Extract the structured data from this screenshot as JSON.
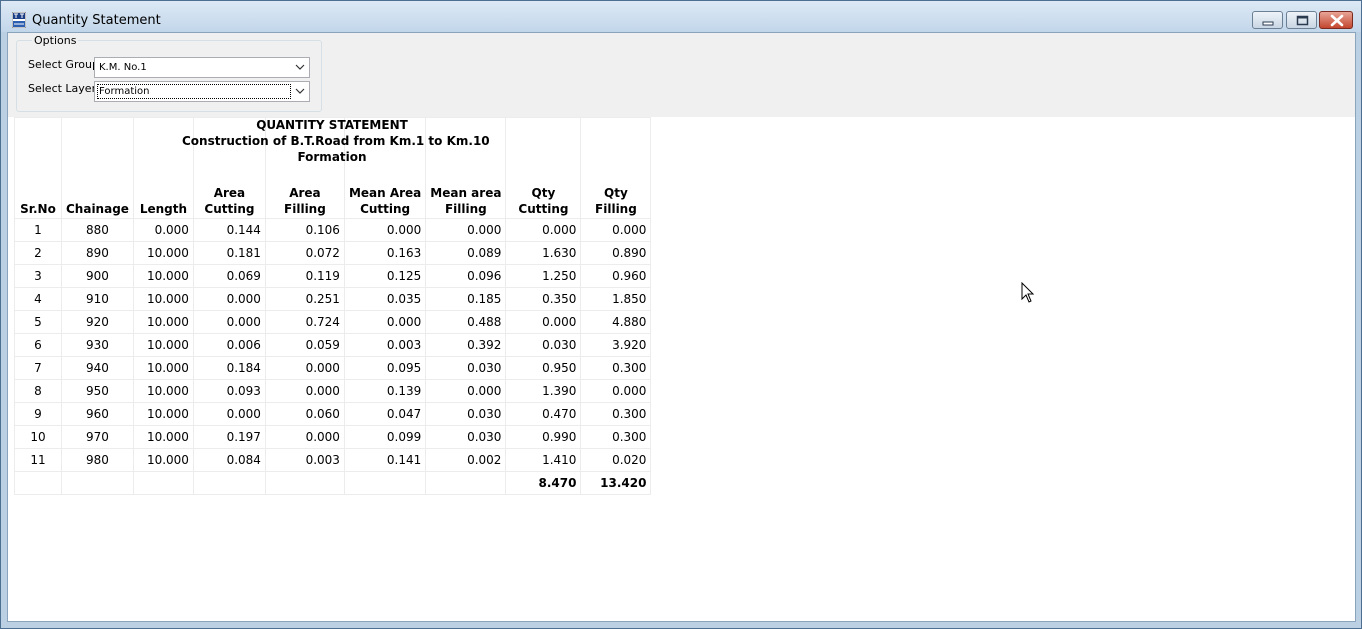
{
  "window": {
    "title": "Quantity Statement"
  },
  "options": {
    "legend": "Options",
    "group_label": "Select Group",
    "group_value": "K.M. No.1",
    "layer_label": "Select Layer",
    "layer_value": "Formation"
  },
  "report": {
    "title": "QUANTITY STATEMENT",
    "subtitle": "Construction of B.T.Road from Km.1 to Km.10",
    "layer": "Formation",
    "columns": [
      [
        "Sr.No"
      ],
      [
        "Chainage"
      ],
      [
        "Length"
      ],
      [
        "Area",
        "Cutting"
      ],
      [
        "Area",
        "Filling"
      ],
      [
        "Mean Area",
        "Cutting"
      ],
      [
        "Mean area",
        "Filling"
      ],
      [
        "Qty",
        "Cutting"
      ],
      [
        "Qty",
        "Filling"
      ]
    ],
    "rows": [
      [
        "1",
        "880",
        "0.000",
        "0.144",
        "0.106",
        "0.000",
        "0.000",
        "0.000",
        "0.000"
      ],
      [
        "2",
        "890",
        "10.000",
        "0.181",
        "0.072",
        "0.163",
        "0.089",
        "1.630",
        "0.890"
      ],
      [
        "3",
        "900",
        "10.000",
        "0.069",
        "0.119",
        "0.125",
        "0.096",
        "1.250",
        "0.960"
      ],
      [
        "4",
        "910",
        "10.000",
        "0.000",
        "0.251",
        "0.035",
        "0.185",
        "0.350",
        "1.850"
      ],
      [
        "5",
        "920",
        "10.000",
        "0.000",
        "0.724",
        "0.000",
        "0.488",
        "0.000",
        "4.880"
      ],
      [
        "6",
        "930",
        "10.000",
        "0.006",
        "0.059",
        "0.003",
        "0.392",
        "0.030",
        "3.920"
      ],
      [
        "7",
        "940",
        "10.000",
        "0.184",
        "0.000",
        "0.095",
        "0.030",
        "0.950",
        "0.300"
      ],
      [
        "8",
        "950",
        "10.000",
        "0.093",
        "0.000",
        "0.139",
        "0.000",
        "1.390",
        "0.000"
      ],
      [
        "9",
        "960",
        "10.000",
        "0.000",
        "0.060",
        "0.047",
        "0.030",
        "0.470",
        "0.300"
      ],
      [
        "10",
        "970",
        "10.000",
        "0.197",
        "0.000",
        "0.099",
        "0.030",
        "0.990",
        "0.300"
      ],
      [
        "11",
        "980",
        "10.000",
        "0.084",
        "0.003",
        "0.141",
        "0.002",
        "1.410",
        "0.020"
      ]
    ],
    "totals": [
      "",
      "",
      "",
      "",
      "",
      "",
      "",
      "8.470",
      "13.420"
    ]
  },
  "icons": {
    "app": "app-icon",
    "minimize": "minimize-icon",
    "maximize": "maximize-icon",
    "close": "close-icon",
    "dropdown": "chevron-down-icon",
    "cursor": "mouse-pointer-icon"
  },
  "colors": {
    "close_button": "#c4462e",
    "window_frame": "#bcd0e4"
  }
}
